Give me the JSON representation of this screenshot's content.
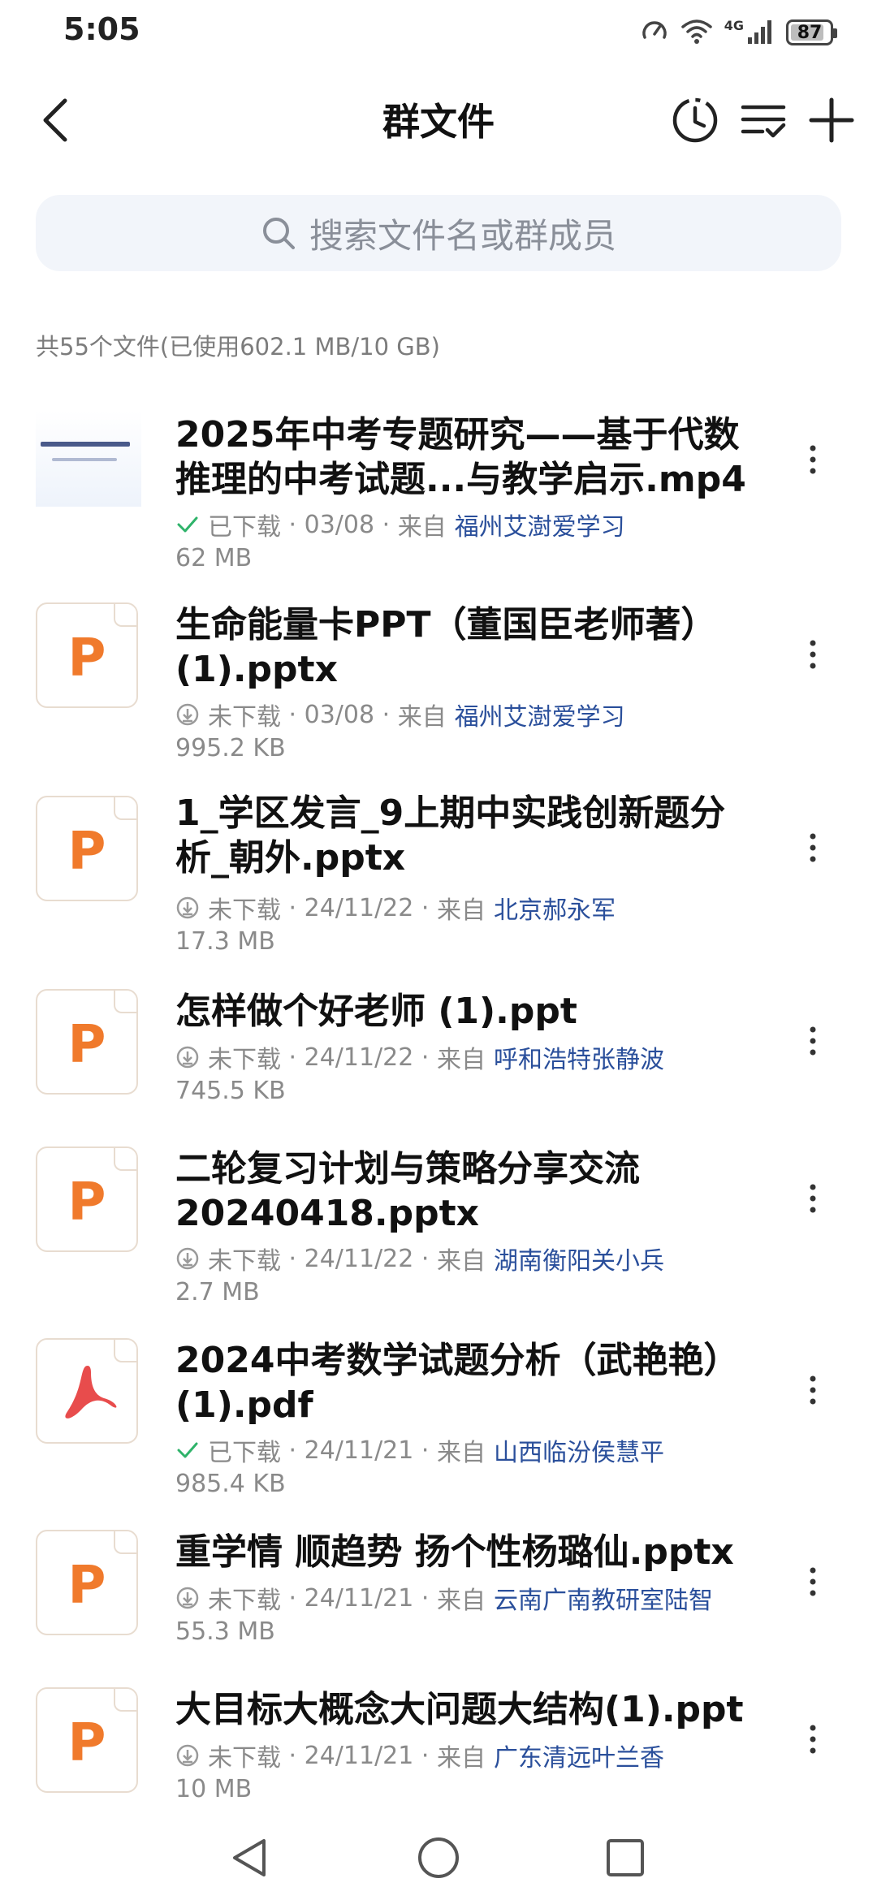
{
  "status_bar": {
    "time": "5:05",
    "network": "4G",
    "battery": "87",
    "battery_level": 87
  },
  "header": {
    "title": "群文件"
  },
  "search": {
    "placeholder": "搜索文件名或群成员"
  },
  "summary": "共55个文件(已使用602.1 MB/10 GB)",
  "files": [
    {
      "name": "2025年中考专题研究——基于代数推理的中考试题...与教学启示.mp4",
      "status": "已下载",
      "date": "03/08",
      "from_label": "来自",
      "uploader": "福州艾澍爱学习",
      "size": "62 MB",
      "icon": "video-thumbnail"
    },
    {
      "name": "生命能量卡PPT（董国臣老师著）(1).pptx",
      "status": "未下载",
      "date": "03/08",
      "from_label": "来自",
      "uploader": "福州艾澍爱学习",
      "size": "995.2 KB",
      "icon": "ppt-icon"
    },
    {
      "name": "1_学区发言_9上期中实践创新题分析_朝外.pptx",
      "status": "未下载",
      "date": "24/11/22",
      "from_label": "来自",
      "uploader": "北京郝永军",
      "size": "17.3 MB",
      "icon": "ppt-icon"
    },
    {
      "name": "怎样做个好老师 (1).ppt",
      "status": "未下载",
      "date": "24/11/22",
      "from_label": "来自",
      "uploader": "呼和浩特张静波",
      "size": "745.5 KB",
      "icon": "ppt-icon"
    },
    {
      "name": "二轮复习计划与策略分享交流20240418.pptx",
      "status": "未下载",
      "date": "24/11/22",
      "from_label": "来自",
      "uploader": "湖南衡阳关小兵",
      "size": "2.7 MB",
      "icon": "ppt-icon"
    },
    {
      "name": "2024中考数学试题分析（武艳艳）(1).pdf",
      "status": "已下载",
      "date": "24/11/21",
      "from_label": "来自",
      "uploader": "山西临汾侯慧平",
      "size": "985.4 KB",
      "icon": "pdf-icon"
    },
    {
      "name": "重学情 顺趋势 扬个性杨璐仙.pptx",
      "status": "未下载",
      "date": "24/11/21",
      "from_label": "来自",
      "uploader": "云南广南教研室陆智",
      "size": "55.3 MB",
      "icon": "ppt-icon"
    },
    {
      "name": "大目标大概念大问题大结构(1).ppt",
      "status": "未下载",
      "date": "24/11/21",
      "from_label": "来自",
      "uploader": "广东清远叶兰香",
      "size": "10 MB",
      "icon": "ppt-icon"
    }
  ],
  "colors": {
    "accent": "#2a4f9b",
    "ppt": "#f07a2c",
    "pdf": "#e84c4c",
    "downloaded": "#2fb36a",
    "meta": "#8a8a8a"
  }
}
